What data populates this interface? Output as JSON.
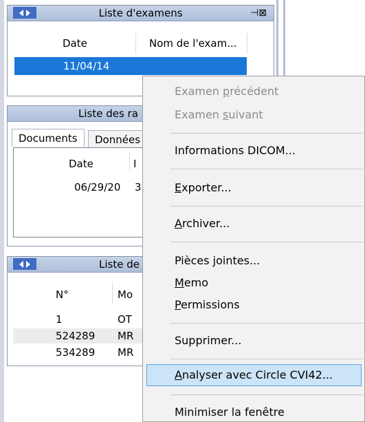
{
  "exam_list": {
    "title": "Liste d'examens",
    "col_date": "Date",
    "col_name": "Nom de l'exam...",
    "row_date": "11/04/14"
  },
  "reports": {
    "title": "Liste des ra",
    "tab_documents": "Documents",
    "tab_data": "Données",
    "col_date": "Date",
    "col_partial": "I",
    "row_date": "06/29/20",
    "row_partial": "3"
  },
  "series_list": {
    "title": "Liste de",
    "col_number": "N°",
    "col_modality": "Mo",
    "rows": [
      {
        "number": "1",
        "modality": "OT"
      },
      {
        "number": "524289",
        "modality": "MR"
      },
      {
        "number": "534289",
        "modality": "MR"
      }
    ]
  },
  "context_menu": {
    "prev_exam": {
      "before": "Examen ",
      "underlined": "p",
      "after": "récédent"
    },
    "next_exam": {
      "before": "Examen ",
      "underlined": "s",
      "after": "uivant"
    },
    "dicom_info": "Informations DICOM...",
    "export": {
      "underlined": "E",
      "after": "xporter..."
    },
    "archive": {
      "underlined": "A",
      "after": "rchiver..."
    },
    "attachments": "Pièces jointes...",
    "memo": {
      "underlined": "M",
      "after": "emo"
    },
    "permissions": {
      "underlined": "P",
      "after": "ermissions"
    },
    "delete": "Supprimer...",
    "analyze": {
      "underlined": "A",
      "after": "nalyser avec Circle CVI42..."
    },
    "minimize": "Minimiser la fenêtre"
  },
  "colors": {
    "accent": "#1a78d8",
    "highlight": "#cce4f7"
  }
}
